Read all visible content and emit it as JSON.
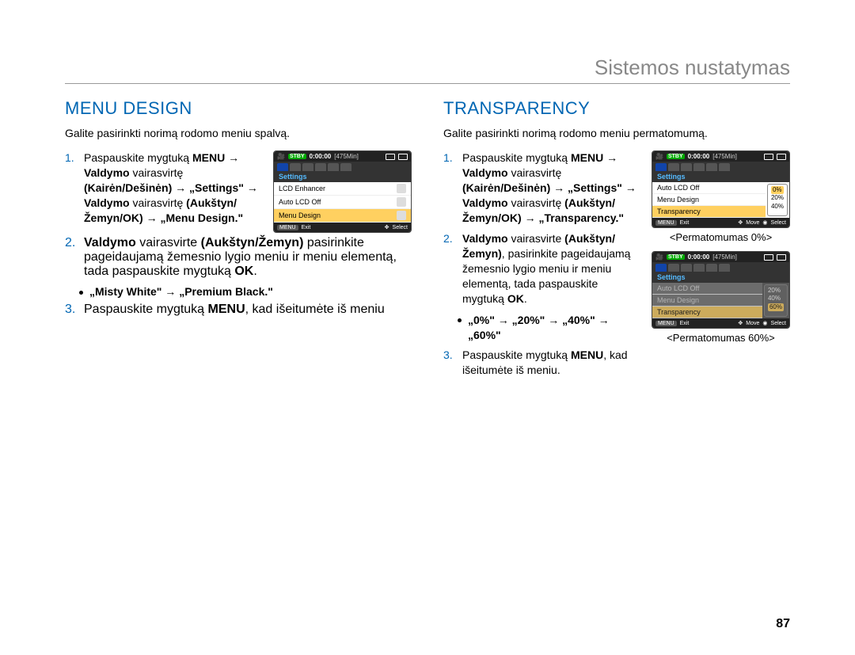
{
  "chapter": "Sistemos nustatymas",
  "pageNumber": "87",
  "left": {
    "title": "MENU DESIGN",
    "intro": "Galite pasirinkti norimą rodomo meniu spalvą.",
    "step1_pre": "Paspauskite mygtuką ",
    "step1_b1": "MENU",
    "arrow": " → ",
    "step1_b2": "Valdymo",
    "step1_t2": " vairasvirtę ",
    "step1_b3": "(Kairėn/Dešinėn)",
    "step1_b4": "„Settings\"",
    "step1_b5": "Valdymo",
    "step1_t5": " vairasvirtę ",
    "step1_b6": "(Aukštyn/Žemyn/OK)",
    "step1_b7": "„Menu Design.\"",
    "step2_b1": "Valdymo",
    "step2_t1": " vairasvirte ",
    "step2_b2": "(Aukštyn/Žemyn)",
    "step2_t2": " pasirinkite pageidaujamą žemesnio lygio meniu ir meniu elementą, tada paspauskite mygtuką ",
    "step2_b3": "OK",
    "bullet": "„Misty White\" → „Premium Black.\"",
    "step3_pre": "Paspauskite mygtuką ",
    "step3_b1": "MENU",
    "step3_post": ", kad išeitumėte iš meniu"
  },
  "right": {
    "title": "TRANSPARENCY",
    "intro": "Galite pasirinkti norimą rodomo meniu permatomumą.",
    "step1_pre": "Paspauskite mygtuką ",
    "step1_b1": "MENU",
    "step1_b2": "Valdymo",
    "step1_t2": " vairasvirtę ",
    "step1_b3": "(Kairėn/Dešinėn)",
    "step1_b4": "„Settings\"",
    "step1_b5": "Valdymo",
    "step1_t5": " vairasvirtę ",
    "step1_b6": "(Aukštyn/Žemyn/OK)",
    "step1_b7": "„Transparency.\"",
    "step2_b1": "Valdymo",
    "step2_t1": " vairasvirte ",
    "step2_b2": "(Aukštyn/Žemyn)",
    "step2_t2": ", pasirinkite pageidaujamą žemesnio lygio meniu ir meniu elementą, tada paspauskite mygtuką ",
    "step2_b3": "OK",
    "bullet": "„0%\" → „20%\" → „40%\" → „60%\"",
    "step3_pre": "Paspauskite mygtuką ",
    "step3_b1": "MENU",
    "step3_post": ", kad išeitumėte iš meniu.",
    "caption1": "<Permatomumas 0%>",
    "caption2": "<Permatomumas 60%>"
  },
  "lcd": {
    "stby": "STBY",
    "time": "0:00:00",
    "remain": "[475Min]",
    "settings": "Settings",
    "rowA": "LCD Enhancer",
    "rowB": "Auto LCD Off",
    "rowC": "Menu Design",
    "rowD": "Transparency",
    "opt0": "0%",
    "opt20": "20%",
    "opt40": "40%",
    "opt60": "60%",
    "footMenu": "MENU",
    "footExit": "Exit",
    "footMove": "Move",
    "footSelect": "Select"
  }
}
